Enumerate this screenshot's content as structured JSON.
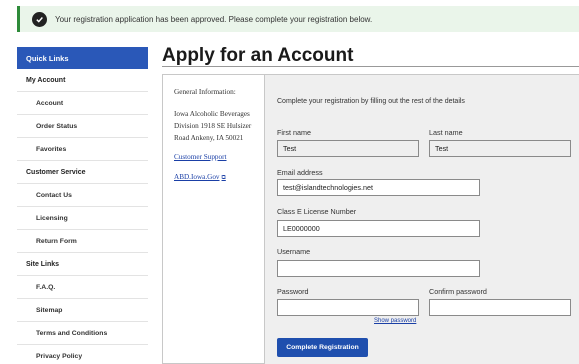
{
  "alert": {
    "message": "Your registration application has been approved. Please complete your registration below.",
    "icon": "check-circle-icon"
  },
  "sidebar": {
    "header": "Quick Links",
    "sections": [
      {
        "title": "My Account",
        "items": [
          "Account",
          "Order Status",
          "Favorites"
        ]
      },
      {
        "title": "Customer Service",
        "items": [
          "Contact Us",
          "Licensing",
          "Return Form"
        ]
      },
      {
        "title": "Site Links",
        "items": [
          "F.A.Q.",
          "Sitemap",
          "Terms and Conditions",
          "Privacy Policy"
        ]
      }
    ]
  },
  "page": {
    "title": "Apply for an Account"
  },
  "info": {
    "heading": "General Information:",
    "address": "Iowa Alcoholic Beverages Division 1918 SE Hulsizer Road Ankeny, IA 50021",
    "support_link": "Customer Support",
    "site_link": "ABD.Iowa.Gov",
    "external_icon": "external-link-icon"
  },
  "form": {
    "intro": "Complete your registration by filling out the rest of the details",
    "first_name": {
      "label": "First name",
      "value": "Test"
    },
    "last_name": {
      "label": "Last name",
      "value": "Test"
    },
    "email": {
      "label": "Email address",
      "value": "test@islandtechnologies.net"
    },
    "license": {
      "label": "Class E License Number",
      "value": "LE0000000"
    },
    "username": {
      "label": "Username",
      "value": ""
    },
    "password": {
      "label": "Password",
      "value": ""
    },
    "confirm_password": {
      "label": "Confirm password",
      "value": ""
    },
    "show_password": "Show password",
    "submit_label": "Complete Registration"
  },
  "colors": {
    "primary": "#2a58b8",
    "success": "#2e8b3a",
    "link": "#1a3fa6"
  }
}
